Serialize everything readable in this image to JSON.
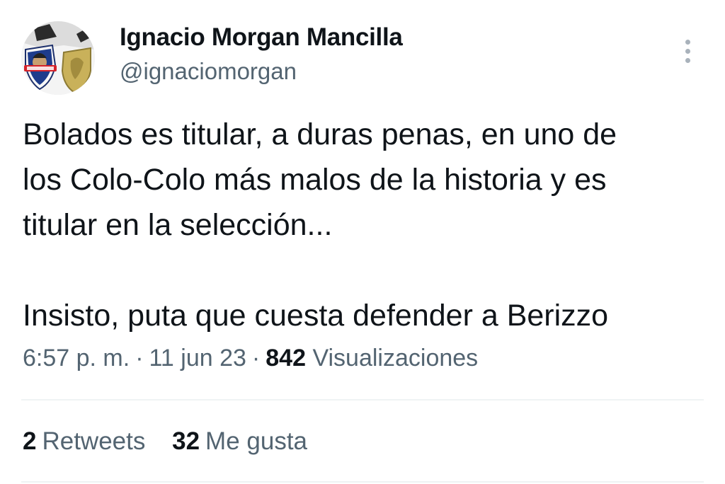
{
  "author": {
    "display_name": "Ignacio Morgan Mancilla",
    "handle": "@ignaciomorgan",
    "avatar_icon": "colo-colo-crest-avatar"
  },
  "tweet": {
    "lines": [
      "Bolados es titular, a duras penas, en uno de",
      "los Colo-Colo más malos de la historia y es",
      "titular en la selección...",
      "",
      "Insisto, puta que cuesta defender a Berizzo"
    ]
  },
  "meta": {
    "time": "6:57 p. m.",
    "separator": "·",
    "date": "11 jun 23",
    "views_count": "842",
    "views_label": "Visualizaciones"
  },
  "stats": {
    "retweets_count": "2",
    "retweets_label": "Retweets",
    "likes_count": "32",
    "likes_label": "Me gusta"
  },
  "colors": {
    "text_primary": "#0f1419",
    "text_secondary": "#536471",
    "divider": "#eff3f4"
  },
  "icons": {
    "more": "more-options-icon"
  }
}
